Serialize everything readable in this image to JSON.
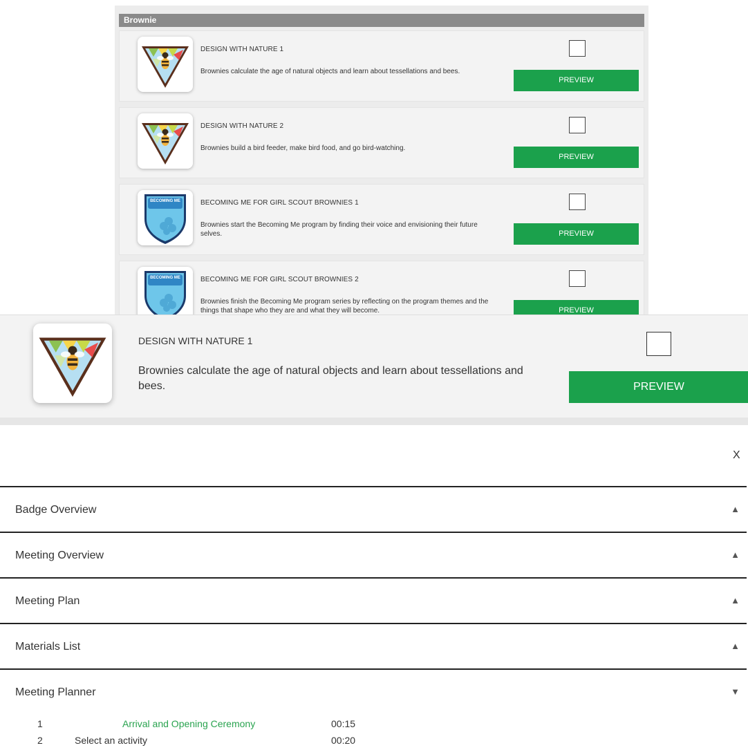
{
  "group": {
    "title": "Brownie"
  },
  "cards": [
    {
      "title": "DESIGN WITH NATURE 1",
      "description": "Brownies calculate the age of natural objects and learn about tessellations and bees.",
      "preview_label": "PREVIEW",
      "badge_icon": "design-with-nature-badge"
    },
    {
      "title": "DESIGN WITH NATURE 2",
      "description": "Brownies build a bird feeder, make bird food, and go bird-watching.",
      "preview_label": "PREVIEW",
      "badge_icon": "design-with-nature-badge"
    },
    {
      "title": "BECOMING ME FOR GIRL SCOUT BROWNIES 1",
      "description": "Brownies start the Becoming Me program by finding their voice and envisioning their future selves.",
      "preview_label": "PREVIEW",
      "badge_icon": "becoming-me-badge",
      "badge_text": "BECOMING ME"
    },
    {
      "title": "BECOMING ME FOR GIRL SCOUT BROWNIES 2",
      "description": "Brownies finish the Becoming Me program series by reflecting on the program themes and the things that shape who they are and what they will become.",
      "preview_label": "PREVIEW",
      "badge_icon": "becoming-me-badge",
      "badge_text": "BECOMING ME"
    }
  ],
  "zoomed_card": {
    "title": "DESIGN WITH NATURE 1",
    "description": "Brownies calculate the age of natural objects and learn about tessellations and bees.",
    "preview_label": "PREVIEW"
  },
  "modal": {
    "close_label": "X",
    "sections": [
      {
        "label": "Badge Overview",
        "arrow": "▲"
      },
      {
        "label": "Meeting Overview",
        "arrow": "▲"
      },
      {
        "label": "Meeting Plan",
        "arrow": "▲"
      },
      {
        "label": "Materials List",
        "arrow": "▲"
      },
      {
        "label": "Meeting Planner",
        "arrow": "▼"
      }
    ],
    "planner": [
      {
        "num": "1",
        "name": "Arrival and Opening Ceremony",
        "time": "00:15"
      },
      {
        "num": "2",
        "name": "Select an activity",
        "time": "00:20"
      }
    ]
  },
  "colors": {
    "accent_green": "#1ba14c",
    "link_green": "#29a34f",
    "header_gray": "#8a8a8a"
  }
}
